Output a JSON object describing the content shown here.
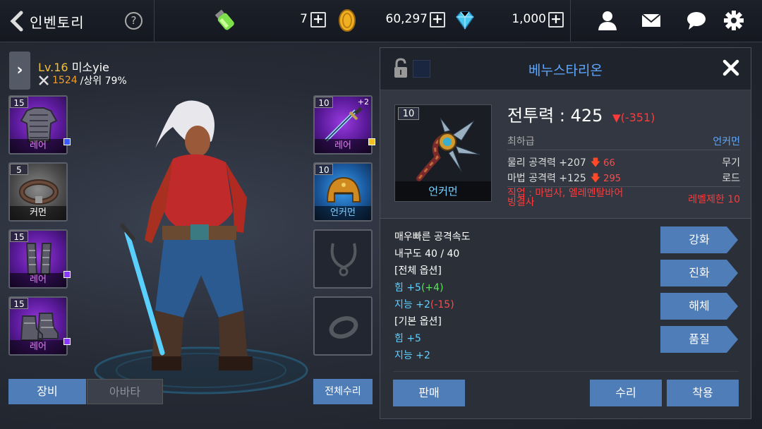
{
  "header": {
    "title": "인벤토리",
    "help": "?",
    "stamina": "7",
    "gold": "60,297",
    "gems": "1,000"
  },
  "character": {
    "level_label": "Lv.16",
    "name": "미소yie",
    "combat_power": "1524",
    "rank_text": "/상위 79%"
  },
  "left_slots": [
    {
      "level": "15",
      "grade": "레어"
    },
    {
      "level": "5",
      "grade": "커먼"
    },
    {
      "level": "15",
      "grade": "레어"
    },
    {
      "level": "15",
      "grade": "레어"
    }
  ],
  "right_slots": [
    {
      "level": "10",
      "grade": "레어",
      "plus": "+2"
    },
    {
      "level": "10",
      "grade": "언커먼"
    }
  ],
  "tabs": {
    "equip": "장비",
    "avatar": "아바타",
    "repair_all": "전체수리"
  },
  "item": {
    "name": "베누스타리온",
    "level": "10",
    "grade": "언커먼",
    "combat_label": "전투력 : 425",
    "combat_diff": "(-351)",
    "quality": "최하급",
    "quality_grade": "언커먼",
    "phys_attack": "물리 공격력 +207",
    "phys_diff": "66",
    "magic_attack": "마법 공격력 +125",
    "magic_diff": "295",
    "type": "무기",
    "subtype": "로드",
    "job_req": "직업 : 마법사, 엘레멘탈바어 빙결사",
    "level_req": "레벨제한 10"
  },
  "stats": {
    "speed": "매우빠른 공격속도",
    "durability": "내구도 40 / 40",
    "all_options_header": "[전체 옵션]",
    "str_base": "힘 +5",
    "str_bonus": "(+4)",
    "int_base": "지능 +2",
    "int_bonus": "(-15)",
    "base_options_header": "[기본 옵션]",
    "str": "힘 +5",
    "int": "지능 +2"
  },
  "side_buttons": [
    "강화",
    "진화",
    "해체",
    "품질"
  ],
  "actions": {
    "sell": "판매",
    "repair": "수리",
    "equip": "착용"
  },
  "colors": {
    "accent_blue": "#4f7db8",
    "title_blue": "#5fa8ff",
    "rare": "#9a3ae0",
    "uncommon": "#3aa0f0",
    "negative": "#ff3a3a"
  }
}
